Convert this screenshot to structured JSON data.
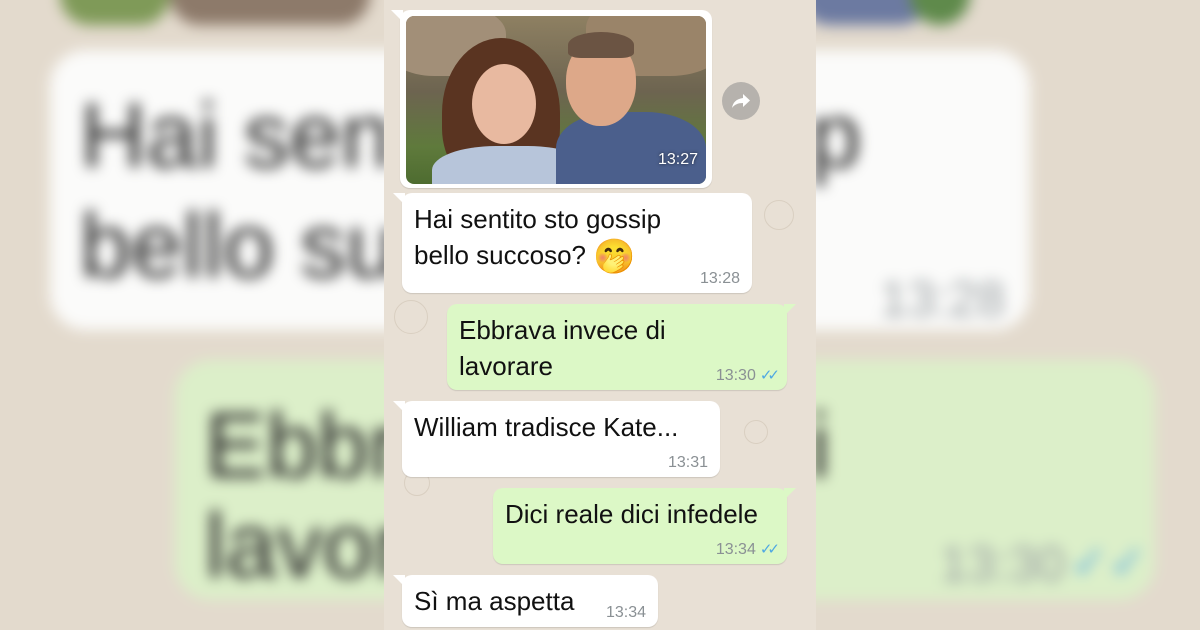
{
  "chat": {
    "messages": [
      {
        "type": "image",
        "direction": "incoming",
        "time": "13:27"
      },
      {
        "type": "text",
        "direction": "incoming",
        "text_line1": "Hai sentito sto gossip",
        "text_line2": "bello succoso?",
        "emoji": "🤭",
        "time": "13:28"
      },
      {
        "type": "text",
        "direction": "outgoing",
        "text_line1": "Ebbrava invece di",
        "text_line2": "lavorare",
        "time": "13:30",
        "ticks": "✓✓"
      },
      {
        "type": "text",
        "direction": "incoming",
        "text": "William tradisce Kate...",
        "time": "13:31"
      },
      {
        "type": "text",
        "direction": "outgoing",
        "text": "Dici reale dici infedele",
        "time": "13:34",
        "ticks": "✓✓"
      },
      {
        "type": "text",
        "direction": "incoming",
        "text": "Sì ma aspetta",
        "time": "13:34"
      }
    ]
  },
  "background_zoom": {
    "white_line1": "Hai senti",
    "white_line1_right": "p",
    "white_line2": "bello suc",
    "white_time": "13:28",
    "green_line1": "Ebbra",
    "green_line1_right": "i",
    "green_line2": "lavora",
    "green_time": "13:30",
    "green_ticks": "✓✓"
  },
  "colors": {
    "incoming_bubble": "#ffffff",
    "outgoing_bubble": "#dcf8c6",
    "read_ticks": "#4fa8e2",
    "wallpaper": "#e8e0d5"
  },
  "icons": {
    "forward": "forward-arrow-icon",
    "emoji": "face-with-hand-over-mouth"
  }
}
